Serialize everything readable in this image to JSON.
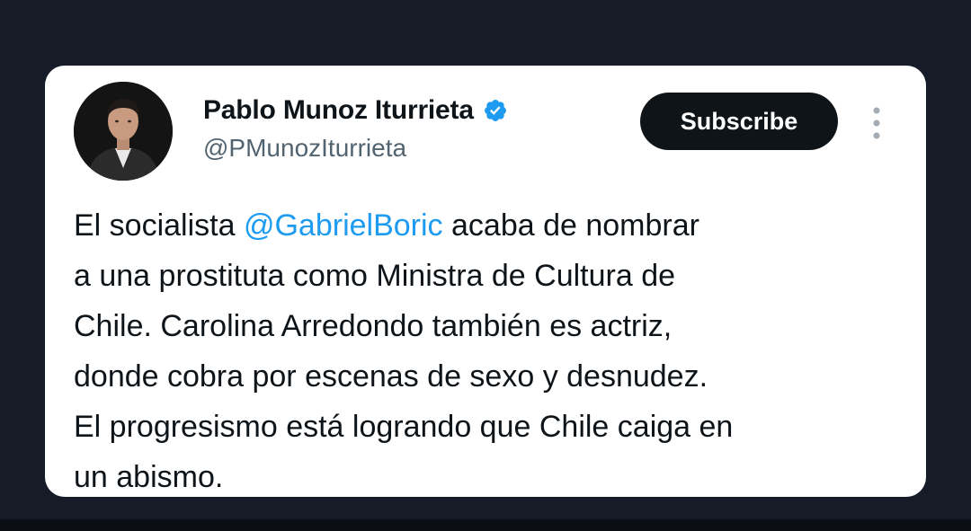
{
  "author": {
    "display_name": "Pablo Munoz Iturrieta",
    "handle": "@PMunozIturrieta",
    "verified_icon": "verified-badge-icon",
    "avatar_icon": "profile-photo"
  },
  "actions": {
    "subscribe_label": "Subscribe",
    "more_icon": "vertical-ellipsis-icon"
  },
  "tweet": {
    "text_before": "El socialista ",
    "mention": "@GabrielBoric",
    "text_after": " acaba de nombrar\na una prostituta como Ministra de Cultura de\nChile. Carolina Arredondo también es actriz,\ndonde cobra por escenas de sexo y desnudez.\nEl progresismo está logrando que Chile caiga en\nun abismo."
  },
  "colors": {
    "background": "#151c27",
    "card": "#ffffff",
    "link": "#1d9bf0",
    "verified": "#1d9bf0",
    "button": "#0f1419"
  }
}
